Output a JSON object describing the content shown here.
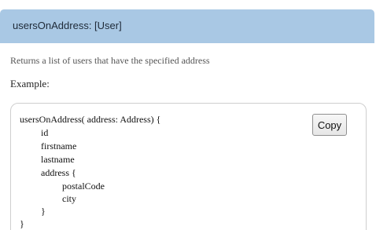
{
  "header": {
    "title": "usersOnAddress: [User]"
  },
  "description": "Returns a list of users that have the specified address",
  "example_label": "Example:",
  "code": {
    "lines": [
      "usersOnAddress( address: Address) {",
      "id",
      "firstname",
      "lastname",
      "address {",
      "postalCode",
      "city",
      "}",
      "}"
    ]
  },
  "copy_button": {
    "label": "Copy"
  },
  "colors": {
    "header_background": "#a9c8e4",
    "code_border": "#cfcfcf"
  }
}
